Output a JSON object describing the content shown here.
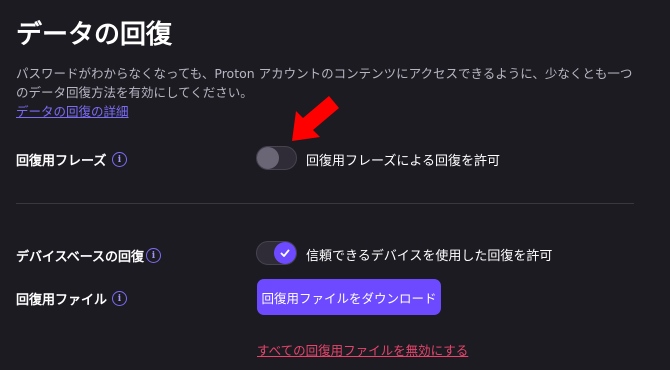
{
  "page": {
    "title": "データの回復",
    "description": "パスワードがわからなくなっても、Proton アカウントのコンテンツにアクセスできるように、少なくとも一つのデータ回復方法を有効にしてください。",
    "details_link": "データの回復の詳細"
  },
  "settings": {
    "recovery_phrase": {
      "label": "回復用フレーズ",
      "toggle_label": "回復用フレーズによる回復を許可",
      "enabled": false
    },
    "device_recovery": {
      "label": "デバイスベースの回復",
      "toggle_label": "信頼できるデバイスを使用した回復を許可",
      "enabled": true
    },
    "recovery_file": {
      "label": "回復用ファイル",
      "download_button": "回復用ファイルをダウンロード",
      "disable_link": "すべての回復用ファイルを無効にする"
    },
    "info_glyph": "i"
  },
  "colors": {
    "background": "#1c1b22",
    "accent": "#6d4aff",
    "link": "#7b6cf6",
    "danger": "#e7456b",
    "annotation_arrow": "#ff0000"
  },
  "icons": {
    "info": "info-circle-icon",
    "check": "check-icon",
    "annotation": "red-arrow-icon"
  }
}
